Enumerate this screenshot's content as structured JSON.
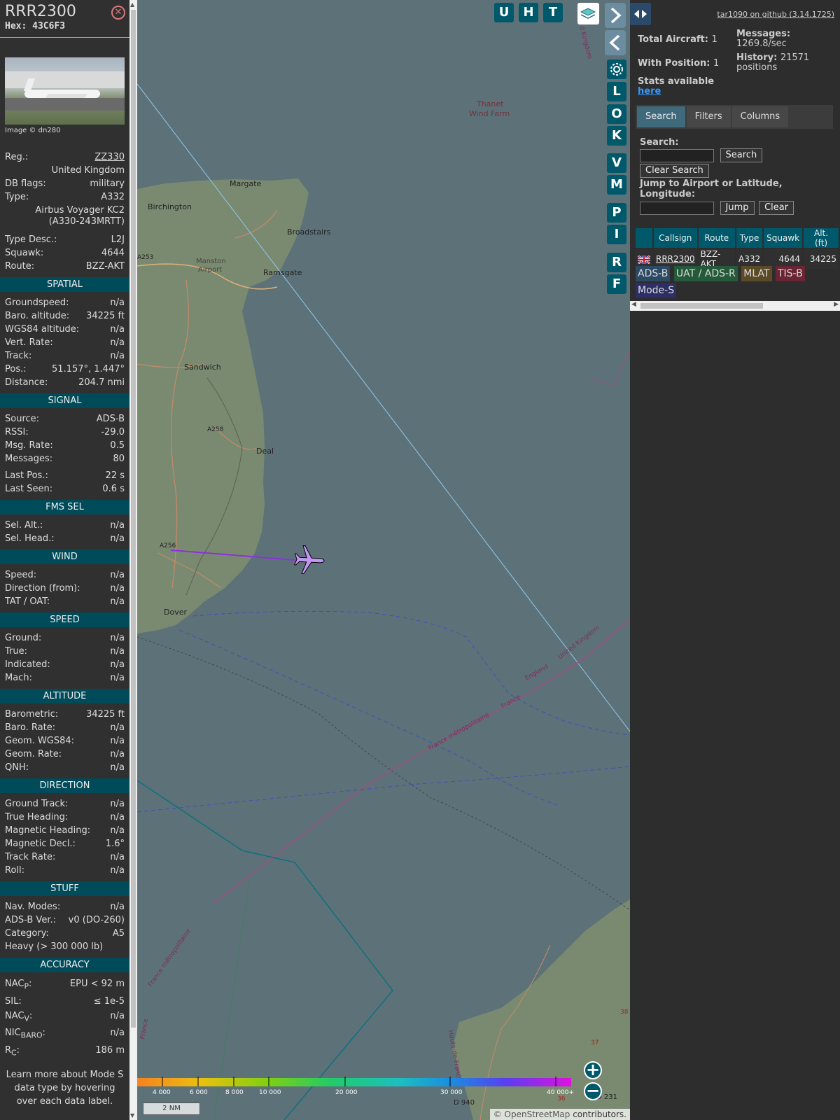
{
  "aircraft": {
    "callsign": "RRR2300",
    "hex": "Hex: 43C6F3",
    "photo_credit": "Image © dn280",
    "registration_label": "Reg.:",
    "registration": "ZZ330",
    "country": "United Kingdom",
    "db_flags_label": "DB flags:",
    "db_flags": "military",
    "type_label": "Type:",
    "type": "A332",
    "type_name": "Airbus Voyager KC2 (A330-243MRTT)",
    "type_desc_label": "Type Desc.:",
    "type_desc": "L2J",
    "squawk_label": "Squawk:",
    "squawk": "4644",
    "route_label": "Route:",
    "route": "BZZ-AKT"
  },
  "sections": {
    "spatial": {
      "title": "SPATIAL",
      "rows": [
        {
          "k": "Groundspeed:",
          "v": "n/a"
        },
        {
          "k": "Baro. altitude:",
          "v": "34225 ft"
        },
        {
          "k": "WGS84 altitude:",
          "v": "n/a"
        },
        {
          "k": "Vert. Rate:",
          "v": "n/a"
        },
        {
          "k": "Track:",
          "v": "n/a"
        },
        {
          "k": "Pos.:",
          "v": "51.157°, 1.447°"
        },
        {
          "k": "Distance:",
          "v": "204.7 nmi"
        }
      ]
    },
    "signal": {
      "title": "SIGNAL",
      "rows": [
        {
          "k": "Source:",
          "v": "ADS-B"
        },
        {
          "k": "RSSI:",
          "v": "-29.0"
        },
        {
          "k": "Msg. Rate:",
          "v": "0.5"
        },
        {
          "k": "Messages:",
          "v": "80"
        }
      ],
      "rows2": [
        {
          "k": "Last Pos.:",
          "v": "22 s"
        },
        {
          "k": "Last Seen:",
          "v": "0.6 s"
        }
      ]
    },
    "fms": {
      "title": "FMS SEL",
      "rows": [
        {
          "k": "Sel. Alt.:",
          "v": "n/a"
        },
        {
          "k": "Sel. Head.:",
          "v": "n/a"
        }
      ]
    },
    "wind": {
      "title": "WIND",
      "rows": [
        {
          "k": "Speed:",
          "v": "n/a"
        },
        {
          "k": "Direction (from):",
          "v": "n/a"
        },
        {
          "k": "TAT / OAT:",
          "v": "n/a"
        }
      ]
    },
    "speed": {
      "title": "SPEED",
      "rows": [
        {
          "k": "Ground:",
          "v": "n/a"
        },
        {
          "k": "True:",
          "v": "n/a"
        },
        {
          "k": "Indicated:",
          "v": "n/a"
        },
        {
          "k": "Mach:",
          "v": "n/a"
        }
      ]
    },
    "altitude": {
      "title": "ALTITUDE",
      "rows": [
        {
          "k": "Barometric:",
          "v": "34225 ft"
        },
        {
          "k": "Baro. Rate:",
          "v": "n/a"
        },
        {
          "k": "Geom. WGS84:",
          "v": "n/a"
        },
        {
          "k": "Geom. Rate:",
          "v": "n/a"
        },
        {
          "k": "QNH:",
          "v": "n/a"
        }
      ]
    },
    "direction": {
      "title": "DIRECTION",
      "rows": [
        {
          "k": "Ground Track:",
          "v": "n/a"
        },
        {
          "k": "True Heading:",
          "v": "n/a"
        },
        {
          "k": "Magnetic Heading:",
          "v": "n/a"
        },
        {
          "k": "Magnetic Decl.:",
          "v": "1.6°"
        },
        {
          "k": "Track Rate:",
          "v": "n/a"
        },
        {
          "k": "Roll:",
          "v": "n/a"
        }
      ]
    },
    "stuff": {
      "title": "STUFF",
      "rows": [
        {
          "k": "Nav. Modes:",
          "v": "n/a"
        },
        {
          "k": "ADS-B Ver.:",
          "v": "v0 (DO-260)"
        },
        {
          "k": "Category:",
          "v": "A5"
        }
      ],
      "category_desc": "Heavy (> 300 000 lb)"
    },
    "accuracy": {
      "title": "ACCURACY",
      "nacp_label": "NAC",
      "nacp_sub": "P",
      "nacp": "EPU < 92 m",
      "sil_label": "SIL:",
      "sil": "≤ 1e-5",
      "nacv_label": "NAC",
      "nacv_sub": "V",
      "nacv": "n/a",
      "nicbaro_label": "NIC",
      "nicbaro_sub": "BARO",
      "nicbaro": "n/a",
      "rc_label": "R",
      "rc_sub": "C",
      "rc": "186 m"
    },
    "learn_more": "Learn more about Mode S data type by hovering over each data label."
  },
  "map": {
    "buttons": [
      "U",
      "H",
      "T",
      "L",
      "O",
      "K",
      "V",
      "M",
      "P",
      "I",
      "R",
      "F"
    ],
    "labels": {
      "margate": "Margate",
      "birchington": "Birchington",
      "broadstairs": "Broadstairs",
      "manston": "Manston",
      "airport": "Airport",
      "ramsgate": "Ramsgate",
      "sandwich": "Sandwich",
      "deal": "Deal",
      "dover": "Dover",
      "thanet1": "Thanet",
      "thanet2": "Wind Farm",
      "a253": "A253",
      "a258": "A258",
      "a256": "A256",
      "england": "England",
      "uk": "United Kingdom",
      "france": "France",
      "france_metro": "France métropolitaine",
      "france_metro2": "France métropolitaine",
      "france_side": "France",
      "hauts": "Hauts-de-France",
      "kingdom_top": "d Kingdom",
      "d940": "D 940",
      "d231": "D 231",
      "n36": "36",
      "n37": "37",
      "n38": "38"
    },
    "altitude_scale": [
      "4 000",
      "6 000",
      "8 000",
      "10 000",
      "20 000",
      "30 000",
      "40 000+"
    ],
    "scale": "2 NM",
    "attribution_osm": "© OpenStreetMap",
    "attribution_rest": " contributors."
  },
  "right": {
    "github": "tar1090 on github (3.14.1725)",
    "total_label": "Total Aircraft:",
    "total": "1",
    "withpos_label": "With Position:",
    "withpos": "1",
    "stats_text": "Stats available",
    "stats_link": "here",
    "messages_label": "Messages:",
    "messages": "1269.8/sec",
    "history_label": "History:",
    "history": "21571 positions",
    "tabs": [
      "Search",
      "Filters",
      "Columns"
    ],
    "search_label": "Search:",
    "search_button": "Search",
    "clear_search_button": "Clear Search",
    "jump_label": "Jump to Airport or Latitude, Longitude:",
    "jump_button": "Jump",
    "clear_button": "Clear",
    "table_headers": [
      "",
      "Callsign",
      "Route",
      "Type",
      "Squawk",
      "Alt. (ft)"
    ],
    "table_row": {
      "callsign": "RRR2300",
      "route": "BZZ-AKT",
      "type": "A332",
      "squawk": "4644",
      "alt": "34225"
    },
    "legend": [
      {
        "label": "ADS-B",
        "color": "#2c4a64"
      },
      {
        "label": "UAT / ADS-R",
        "color": "#245a3a"
      },
      {
        "label": "MLAT",
        "color": "#5a4a26"
      },
      {
        "label": "TIS-B",
        "color": "#6a2433"
      },
      {
        "label": "Mode-S",
        "color": "#2e2e66"
      }
    ]
  }
}
